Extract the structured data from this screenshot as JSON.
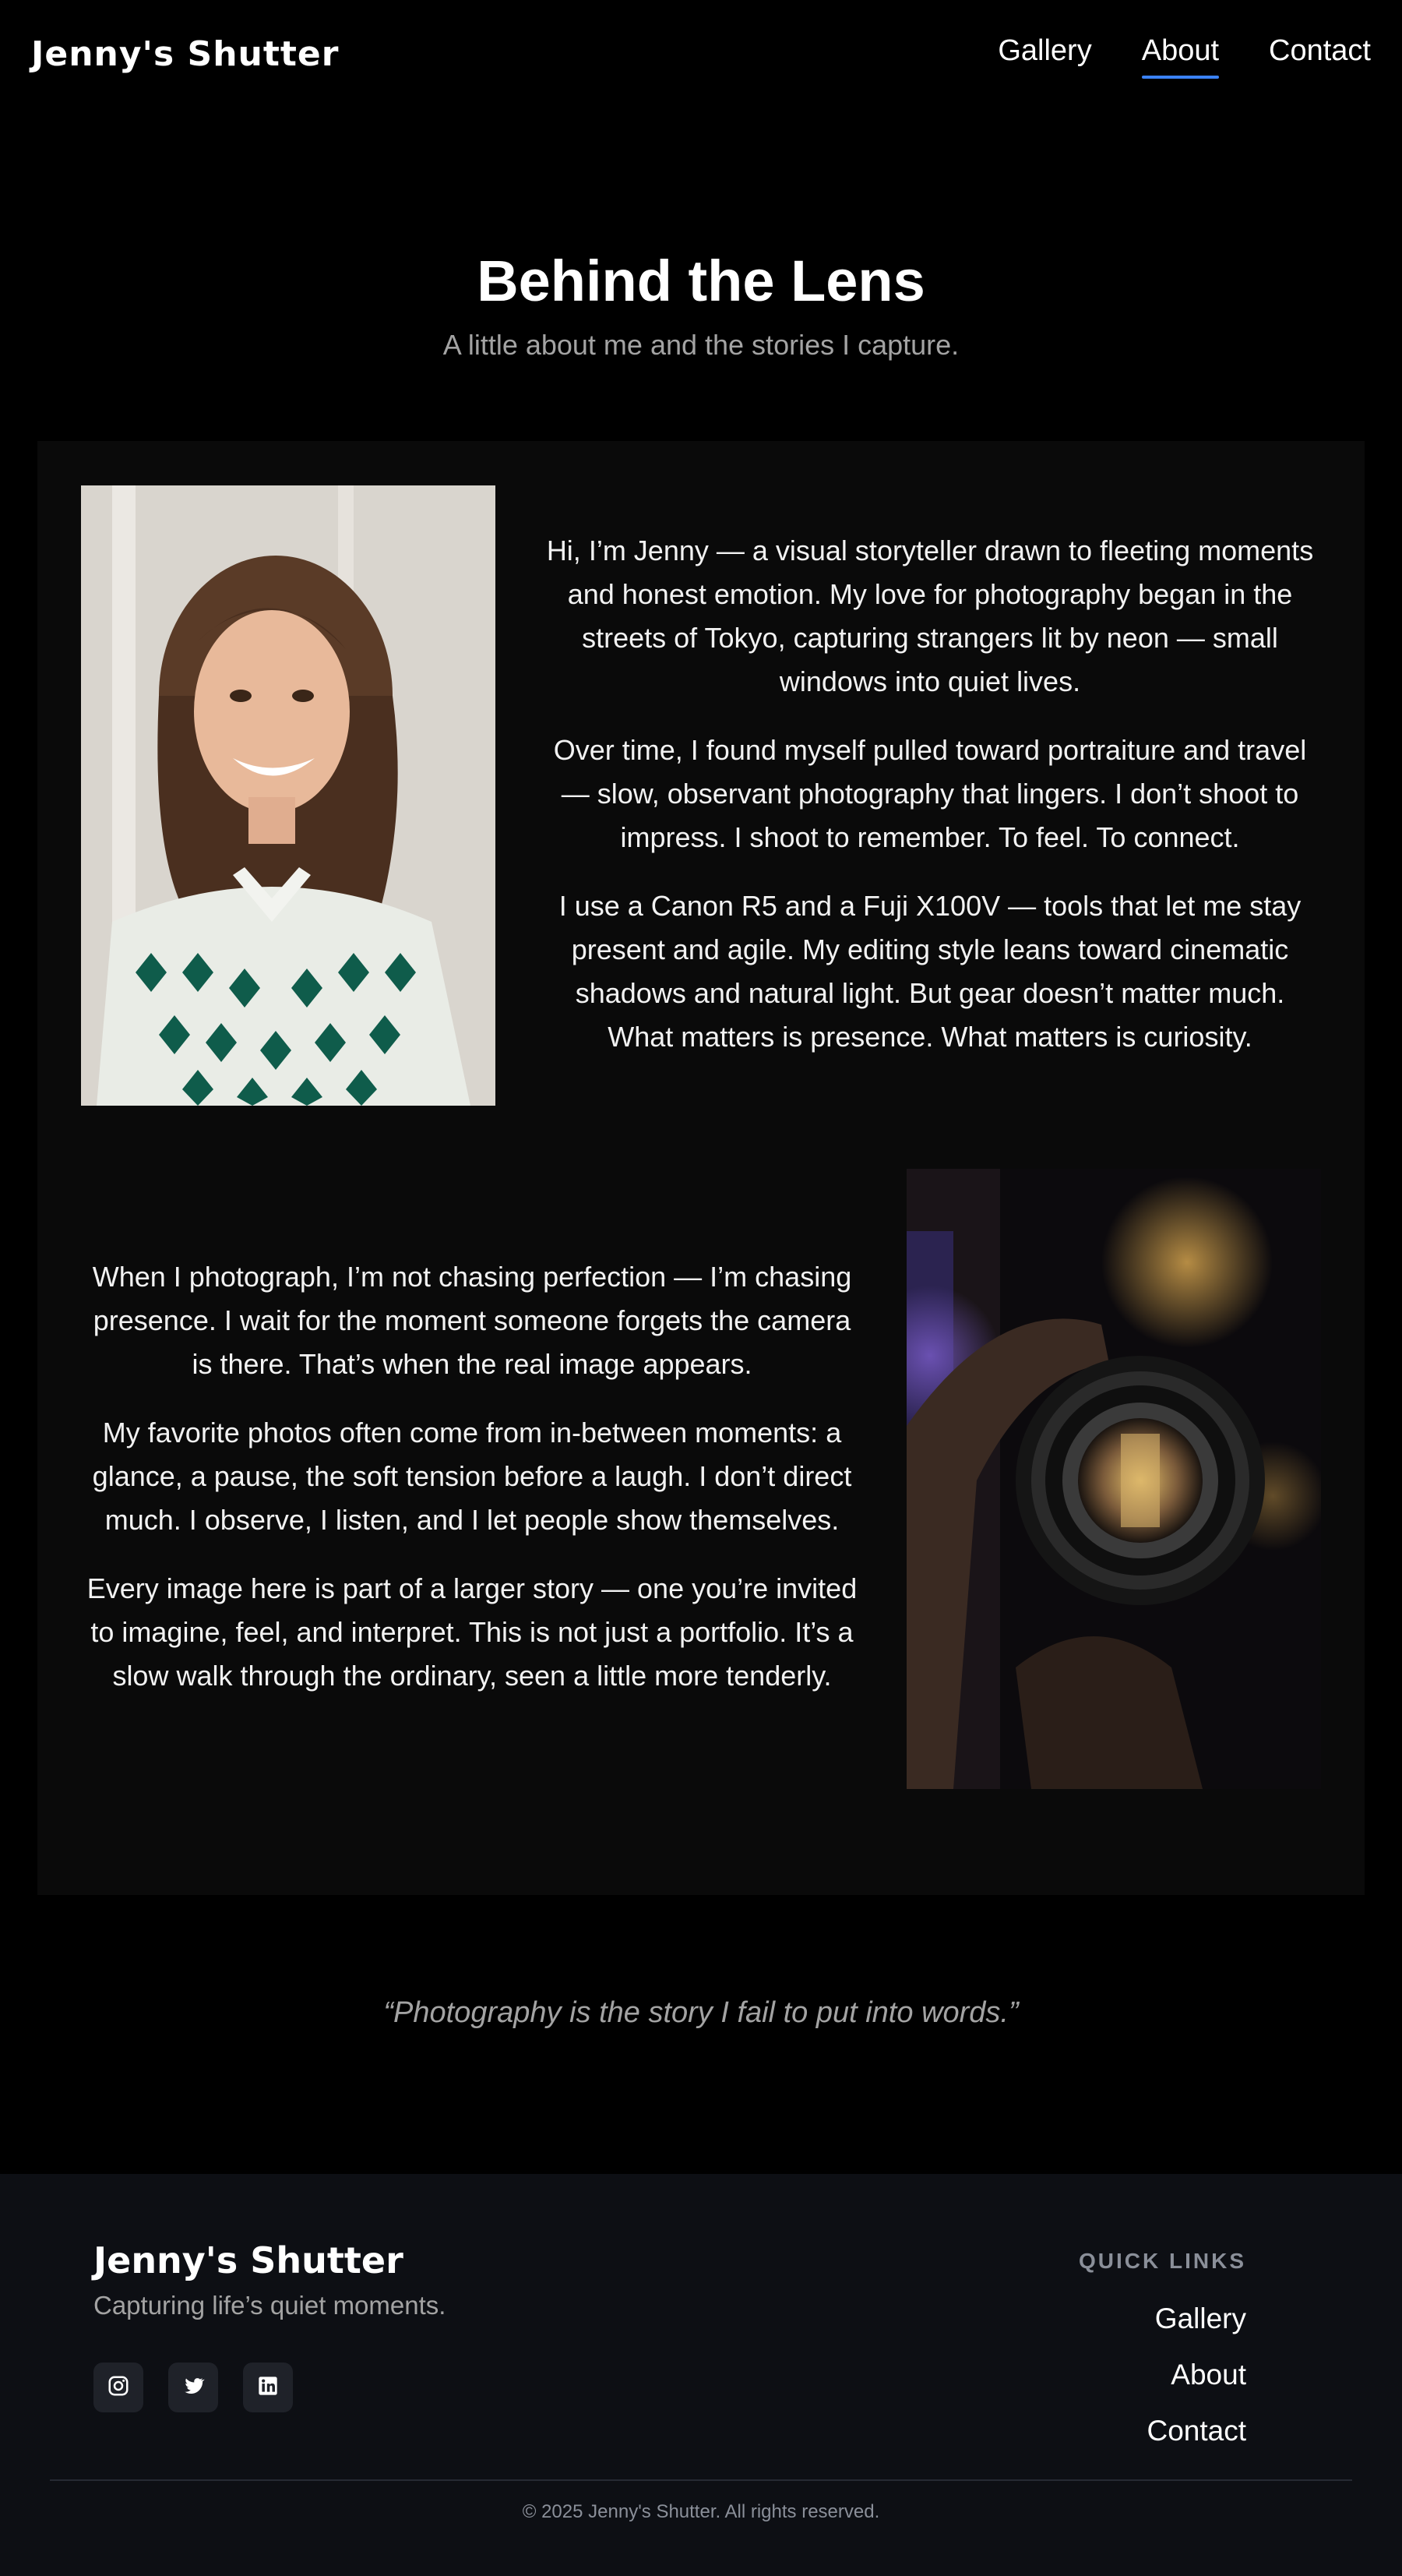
{
  "header": {
    "logo": "Jenny's Shutter",
    "nav": [
      "Gallery",
      "About",
      "Contact"
    ],
    "active_nav": "About"
  },
  "hero": {
    "title": "Behind the Lens",
    "subtitle": "A little about me and the stories I capture."
  },
  "about": {
    "block1": [
      "Hi, I’m Jenny — a visual storyteller drawn to fleeting moments and honest emotion. My love for photography began in the streets of Tokyo, capturing strangers lit by neon — small windows into quiet lives.",
      "Over time, I found myself pulled toward portraiture and travel — slow, observant photography that lingers. I don’t shoot to impress. I shoot to remember. To feel. To connect.",
      "I use a Canon R5 and a Fuji X100V — tools that let me stay present and agile. My editing style leans toward cinematic shadows and natural light. But gear doesn’t matter much. What matters is presence. What matters is curiosity."
    ],
    "block2": [
      "When I photograph, I’m not chasing perfection — I’m chasing presence. I wait for the moment someone forgets the camera is there. That’s when the real image appears.",
      "My favorite photos often come from in-between moments: a glance, a pause, the soft tension before a laugh. I don’t direct much. I observe, I listen, and I let people show themselves.",
      "Every image here is part of a larger story — one you’re invited to imagine, feel, and interpret. This is not just a portfolio. It’s a slow walk through the ordinary, seen a little more tenderly."
    ]
  },
  "quote": "“Photography is the story I fail to put into words.”",
  "footer": {
    "brand": "Jenny's Shutter",
    "tagline": "Capturing life’s quiet moments.",
    "socials": [
      "instagram-icon",
      "twitter-icon",
      "linkedin-icon"
    ],
    "quick_links_title": "QUICK LINKS",
    "quick_links": [
      "Gallery",
      "About",
      "Contact"
    ],
    "copyright": "© 2025 Jenny's Shutter. All rights reserved."
  },
  "colors": {
    "background": "#000000",
    "card": "#0a0a0a",
    "footer": "#0d0f14",
    "accent": "#3b82f6",
    "muted": "#a3a3a3"
  }
}
